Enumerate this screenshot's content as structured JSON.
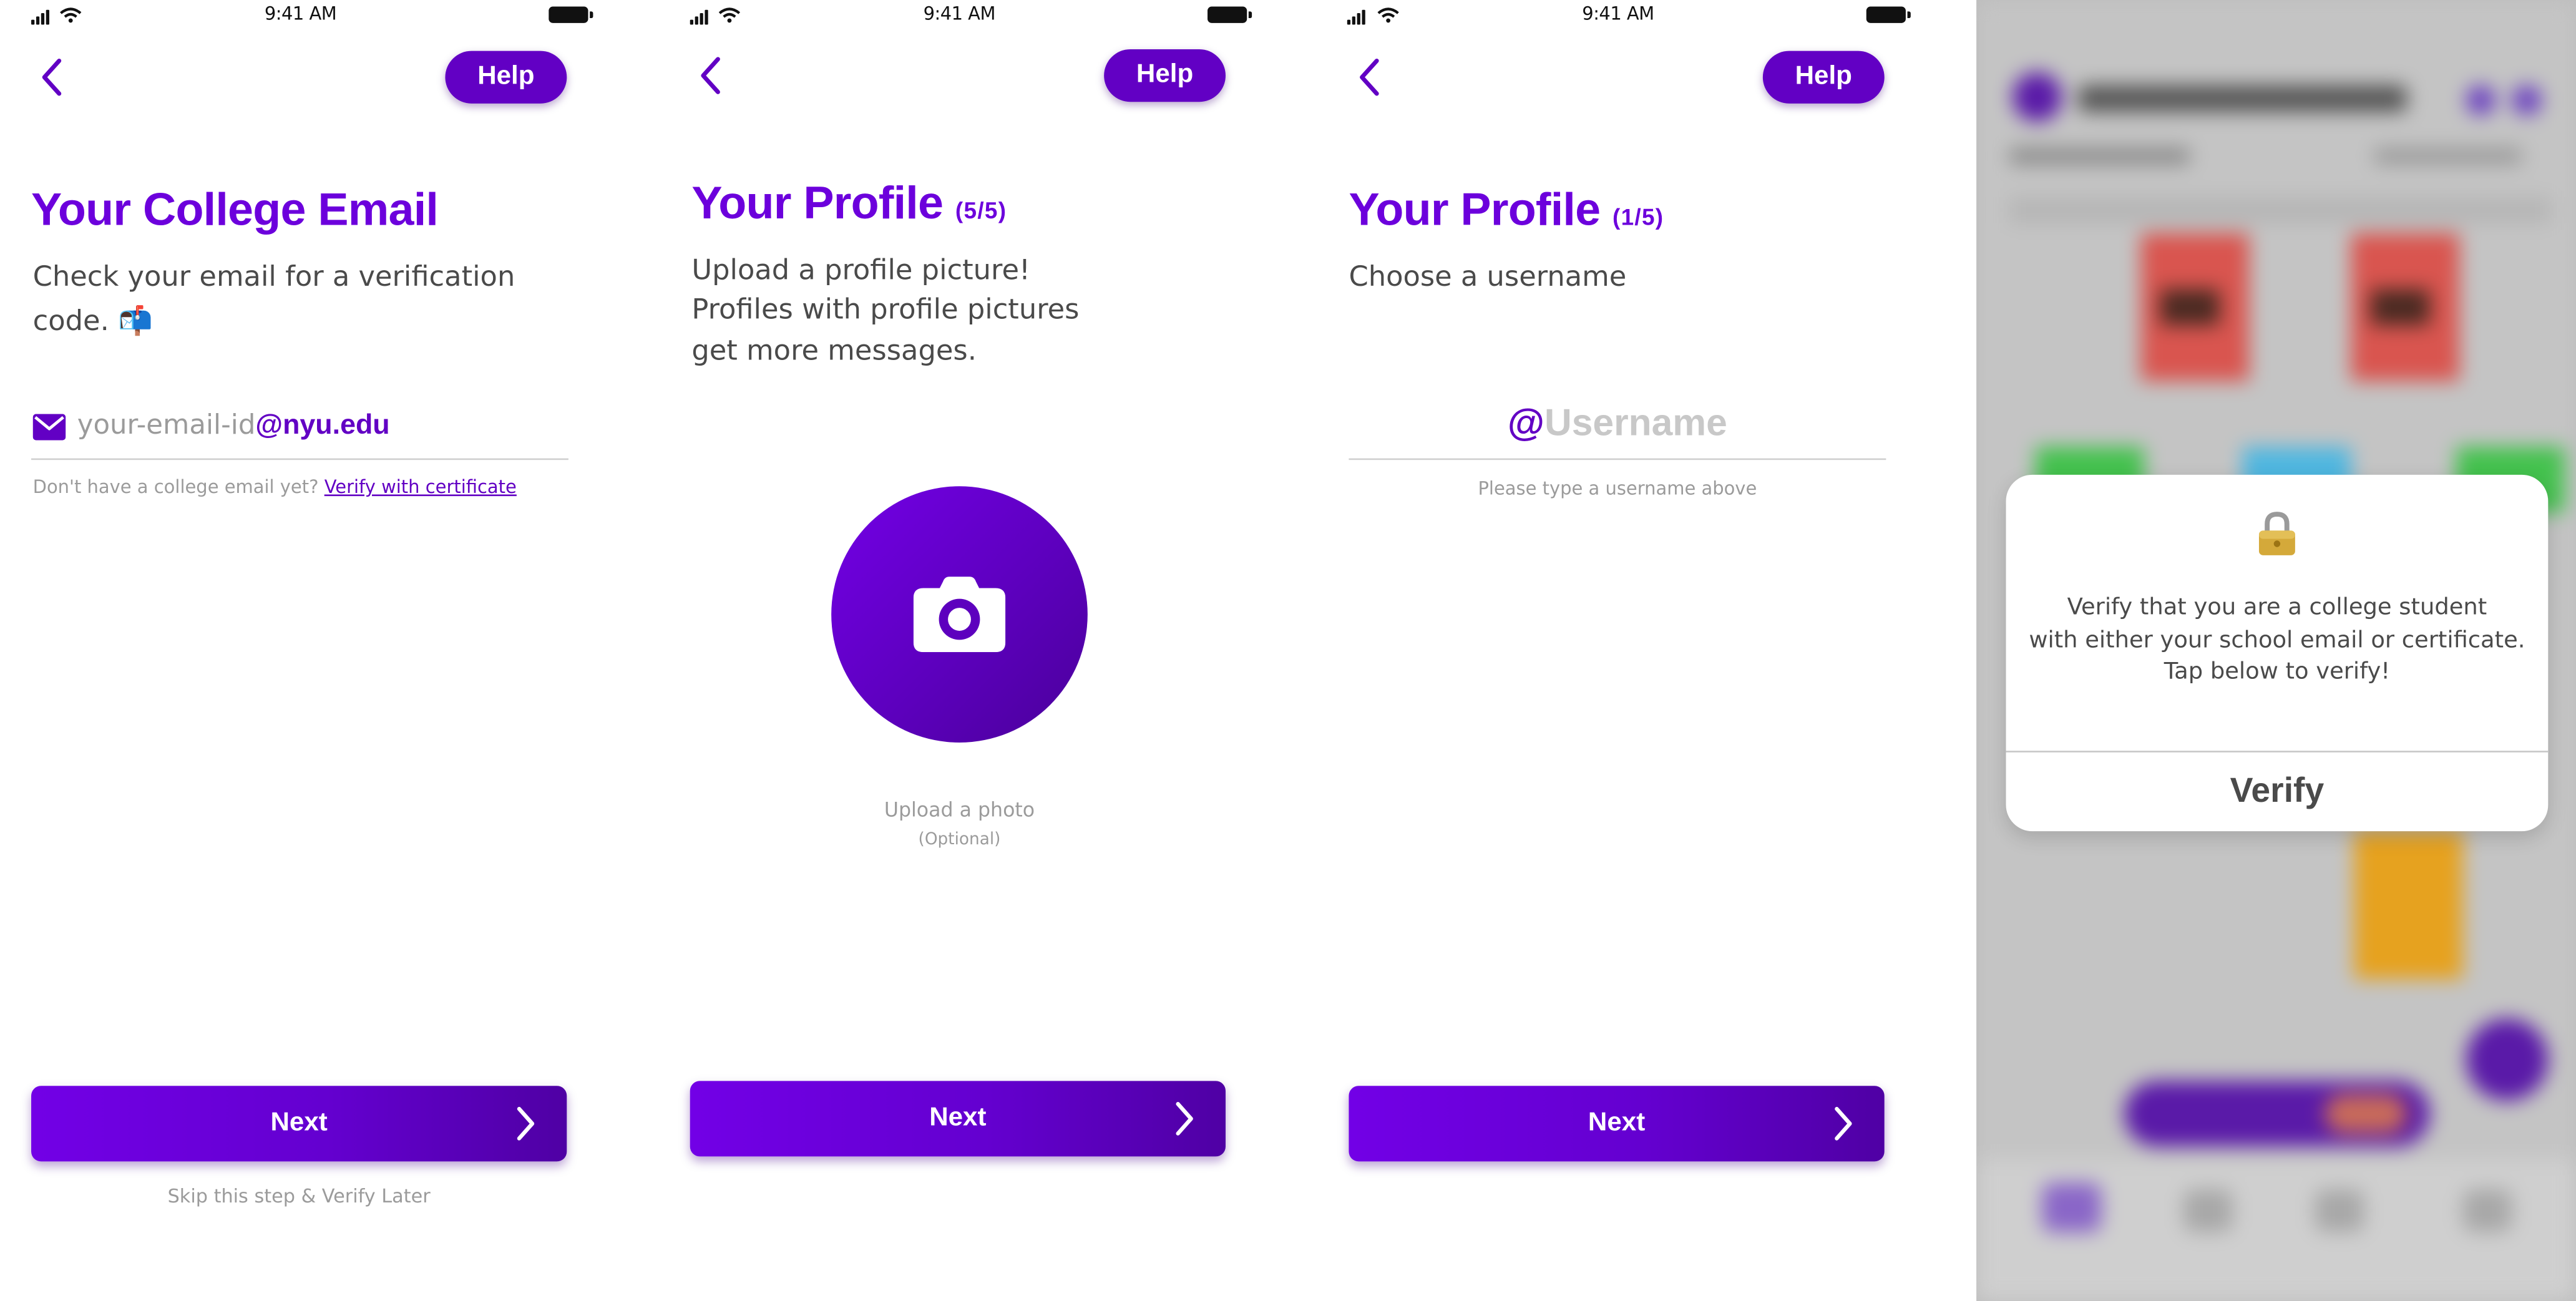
{
  "status_bar": {
    "time": "9:41 AM"
  },
  "colors": {
    "brand_purple": "#6200c4",
    "heading_purple": "#6c00dc",
    "text_grey": "#4a4a4a",
    "hint_grey": "#9b9b9b"
  },
  "screen_email": {
    "help_label": "Help",
    "title": "Your College Email",
    "subtitle_line1": "Check your email for a verification",
    "subtitle_line2": "code. 📬",
    "field_icon": "envelope-icon",
    "email_placeholder": "your-email-id",
    "email_domain": "@nyu.edu",
    "no_email_text": "Don't have a college email yet?",
    "verify_link": "Verify with certificate",
    "next_label": "Next",
    "skip_label": "Skip this step & Verify Later"
  },
  "screen_photo": {
    "help_label": "Help",
    "title": "Your Profile",
    "step": "(5/5)",
    "subtitle_line1": "Upload a profile picture!",
    "subtitle_line2": "Profiles with profile pictures",
    "subtitle_line3": "get more messages.",
    "camera_icon": "camera-icon",
    "upload_label": "Upload a photo",
    "optional_label": "(Optional)",
    "next_label": "Next"
  },
  "screen_username": {
    "help_label": "Help",
    "title": "Your Profile",
    "step": "(1/5)",
    "subtitle": "Choose a username",
    "at_sign": "@",
    "username_placeholder": "Username",
    "hint": "Please type a username above",
    "next_label": "Next"
  },
  "screen_verify_modal": {
    "lock_icon": "lock-icon",
    "message_line1": "Verify that you are a college student",
    "message_line2": "with either your school email or certificate.",
    "message_line3": "Tap below to verify!",
    "verify_label": "Verify"
  }
}
